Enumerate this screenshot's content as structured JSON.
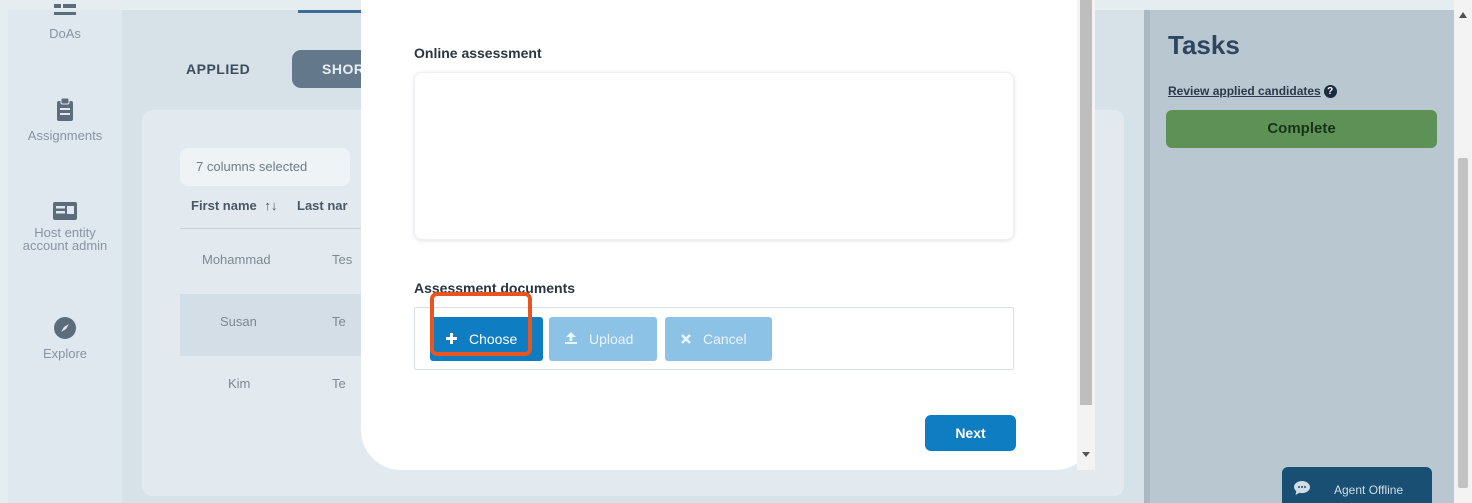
{
  "nav": {
    "items": [
      {
        "label": "DoAs",
        "icon": "list-icon"
      },
      {
        "label": "Assignments",
        "icon": "clipboard-icon"
      },
      {
        "label": "Host entity account admin",
        "icon": "id-card-icon"
      },
      {
        "label": "Explore",
        "icon": "compass-icon"
      }
    ]
  },
  "main": {
    "tabs": [
      {
        "label": "APPLIED"
      },
      {
        "label": "SHOR"
      }
    ],
    "column_select": "7 columns selected",
    "table": {
      "headers": [
        "First name",
        "Last nar"
      ],
      "sort_icon": "↑↓",
      "rows": [
        {
          "first": "Mohammad",
          "last": "Tes"
        },
        {
          "first": "Susan",
          "last": "Te"
        },
        {
          "first": "Kim",
          "last": "Te"
        }
      ]
    }
  },
  "modal": {
    "online_assessment_label": "Online assessment",
    "assessment_value": "",
    "assessment_documents_label": "Assessment documents",
    "buttons": {
      "choose": "Choose",
      "upload": "Upload",
      "cancel": "Cancel",
      "next": "Next"
    }
  },
  "tasks": {
    "title": "Tasks",
    "review_link": "Review applied candidates",
    "help_icon_glyph": "?",
    "complete": "Complete"
  },
  "chat": {
    "label": "Agent Offline"
  },
  "colors": {
    "primary_blue": "#0f7dc2",
    "highlight_orange": "#e8551f",
    "complete_green": "#5d9156"
  }
}
